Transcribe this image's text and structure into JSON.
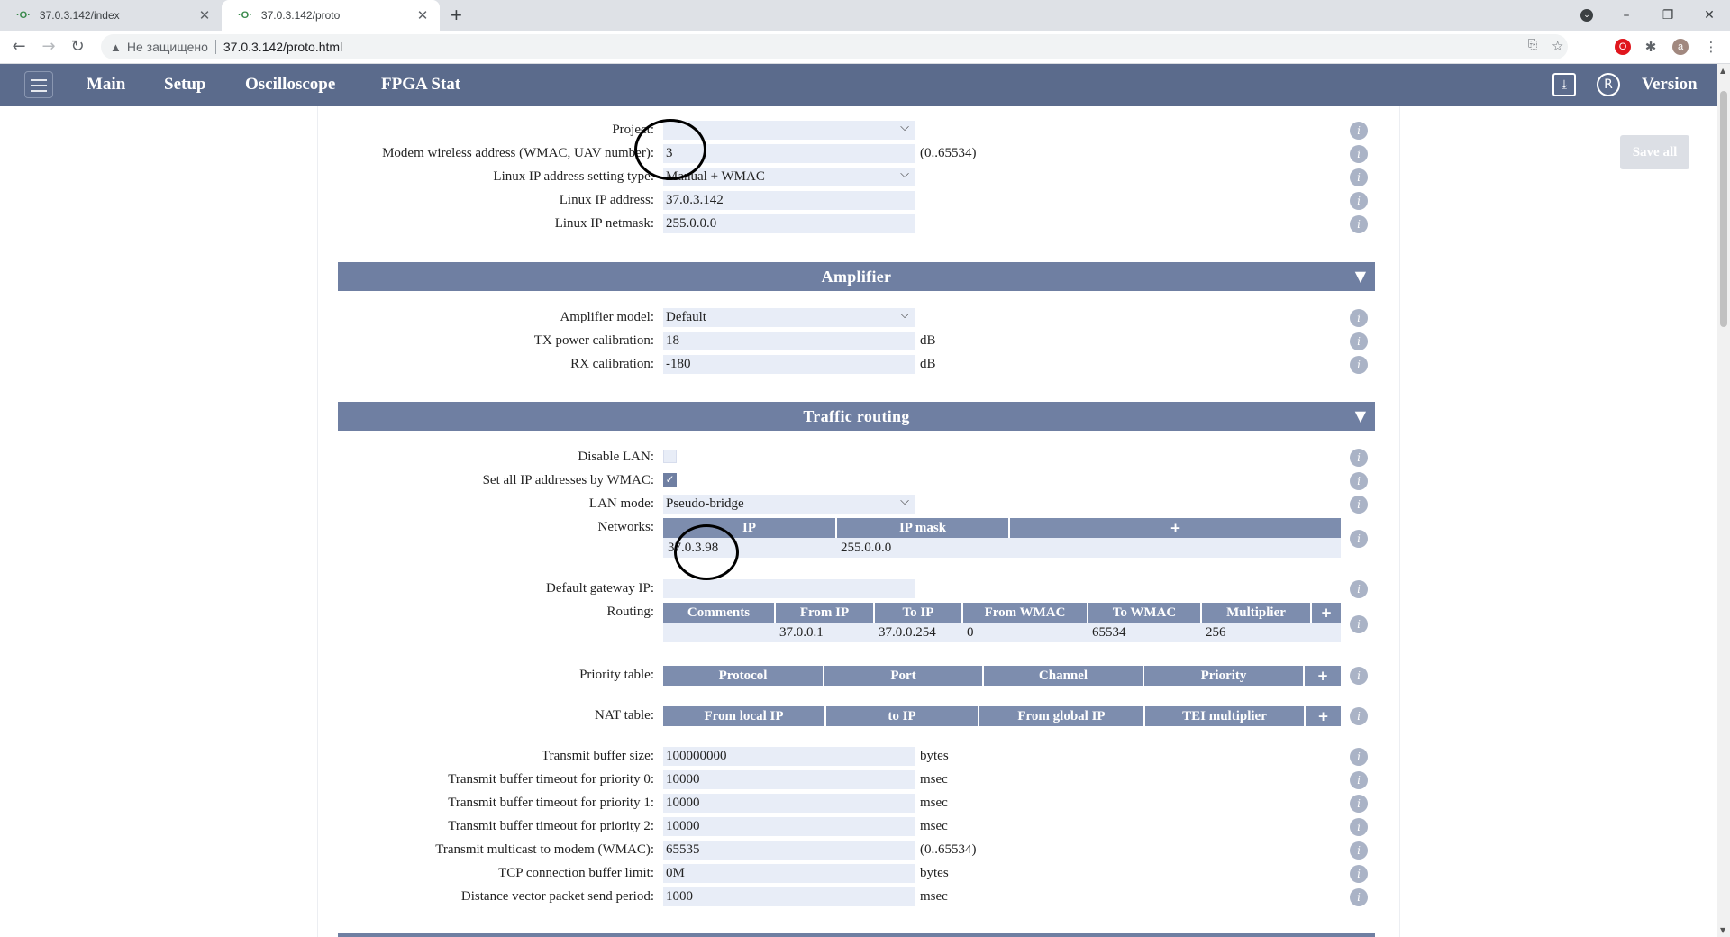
{
  "browser": {
    "tabs": [
      {
        "title": "37.0.3.142/index",
        "active": false
      },
      {
        "title": "37.0.3.142/proto",
        "active": true
      }
    ],
    "new_tab": "+",
    "not_secure": "Не защищено",
    "url": "37.0.3.142/proto.html",
    "profile_initial": "a"
  },
  "nav": {
    "items": [
      "Main",
      "Setup",
      "Oscilloscope",
      "FPGA Stat"
    ],
    "version": "Version"
  },
  "save_all": "Save all",
  "top_fields": [
    {
      "label": "Project:",
      "value": "",
      "type": "select"
    },
    {
      "label": "Modem wireless address (WMAC, UAV number):",
      "value": "3",
      "unit": "(0..65534)"
    },
    {
      "label": "Linux IP address setting type:",
      "value": "Manual + WMAC",
      "type": "select"
    },
    {
      "label": "Linux IP address:",
      "value": "37.0.3.142"
    },
    {
      "label": "Linux IP netmask:",
      "value": "255.0.0.0"
    }
  ],
  "amplifier": {
    "title": "Amplifier",
    "fields": [
      {
        "label": "Amplifier model:",
        "value": "Default",
        "type": "select"
      },
      {
        "label": "TX power calibration:",
        "value": "18",
        "unit": "dB"
      },
      {
        "label": "RX calibration:",
        "value": "-180",
        "unit": "dB"
      }
    ]
  },
  "traffic": {
    "title": "Traffic routing",
    "disable_lan": {
      "label": "Disable LAN:",
      "checked": false
    },
    "set_all_ip": {
      "label": "Set all IP addresses by WMAC:",
      "checked": true,
      "mark": "✓"
    },
    "lan_mode": {
      "label": "LAN mode:",
      "value": "Pseudo-bridge"
    },
    "networks": {
      "label": "Networks:",
      "columns": [
        "IP",
        "IP mask",
        "+"
      ],
      "rows": [
        [
          "37.0.3.98",
          "255.0.0.0",
          ""
        ]
      ]
    },
    "gateway": {
      "label": "Default gateway IP:",
      "value": ""
    },
    "routing": {
      "label": "Routing:",
      "columns": [
        "Comments",
        "From IP",
        "To IP",
        "From WMAC",
        "To WMAC",
        "Multiplier",
        "+"
      ],
      "rows": [
        [
          "",
          "37.0.0.1",
          "37.0.0.254",
          "0",
          "65534",
          "256",
          ""
        ]
      ]
    },
    "priority": {
      "label": "Priority table:",
      "columns": [
        "Protocol",
        "Port",
        "Channel",
        "Priority",
        "+"
      ]
    },
    "nat": {
      "label": "NAT table:",
      "columns": [
        "From local IP",
        "to IP",
        "From global IP",
        "TEI multiplier",
        "+"
      ]
    },
    "buffer_fields": [
      {
        "label": "Transmit buffer size:",
        "value": "100000000",
        "unit": "bytes"
      },
      {
        "label": "Transmit buffer timeout for priority 0:",
        "value": "10000",
        "unit": "msec"
      },
      {
        "label": "Transmit buffer timeout for priority 1:",
        "value": "10000",
        "unit": "msec"
      },
      {
        "label": "Transmit buffer timeout for priority 2:",
        "value": "10000",
        "unit": "msec"
      },
      {
        "label": "Transmit multicast to modem (WMAC):",
        "value": "65535",
        "unit": "(0..65534)"
      },
      {
        "label": "TCP connection buffer limit:",
        "value": "0M",
        "unit": "bytes"
      },
      {
        "label": "Distance vector packet send period:",
        "value": "1000",
        "unit": "msec"
      }
    ]
  },
  "icons": {
    "info": "i",
    "collapse": "▼",
    "download": "⤓",
    "registered": "R",
    "back": "←",
    "forward": "→",
    "reload": "↻",
    "warning": "▲",
    "translate": "⎘",
    "star": "☆",
    "puzzle": "✱",
    "menu": "⋮",
    "close": "✕",
    "minimize": "–",
    "restore": "❐",
    "chrome_menu": "⬤"
  }
}
